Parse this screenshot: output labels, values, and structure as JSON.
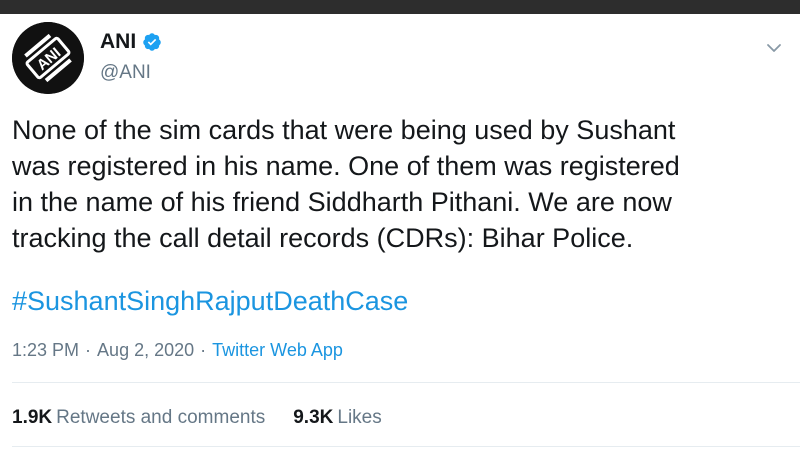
{
  "tweet": {
    "author_name": "ANI",
    "author_handle": "@ANI",
    "avatar_text": "ANI",
    "verified": true,
    "text_lines": "None of the sim cards that were being used by Sushant\nwas registered in his name. One of them was registered\nin the name of his friend Siddharth Pithani. We are now\ntracking the call detail records (CDRs): Bihar Police.",
    "hashtag": "#SushantSinghRajputDeathCase",
    "time": "1:23 PM",
    "separator": "·",
    "date": "Aug 2, 2020",
    "source": "Twitter Web App"
  },
  "stats": {
    "retweets_count": "1.9K",
    "retweets_label": "Retweets and comments",
    "likes_count": "9.3K",
    "likes_label": "Likes"
  },
  "colors": {
    "link": "#1b95e0",
    "muted": "#657786",
    "text": "#14171a",
    "verified_badge": "#1da1f2"
  },
  "icons": {
    "verified": "verified-badge-icon",
    "menu": "chevron-down-icon"
  }
}
